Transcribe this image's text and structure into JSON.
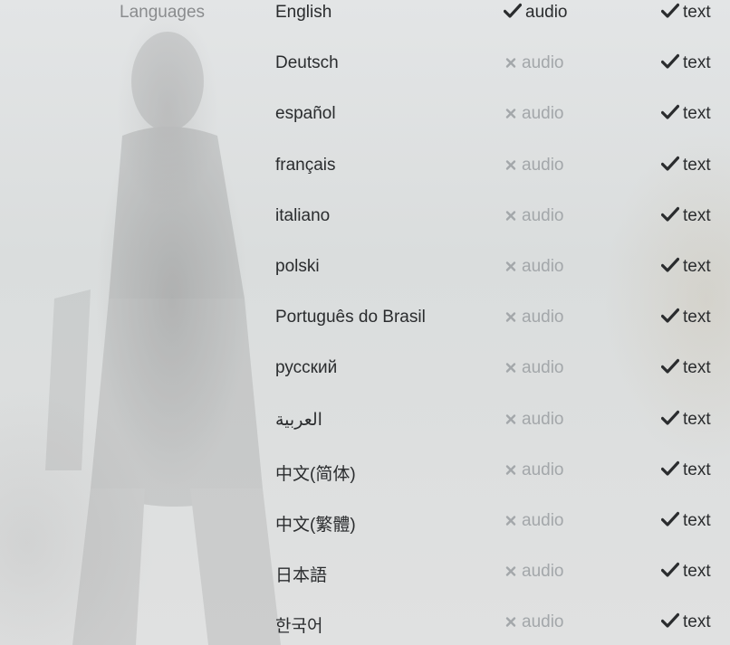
{
  "section_label": "Languages",
  "colors": {
    "supported": "#2a2c2e",
    "unsupported": "#a3a7aa"
  },
  "languages": [
    {
      "name": "English",
      "audio": {
        "supported": true,
        "label": "audio",
        "icon": "check-icon"
      },
      "text": {
        "supported": true,
        "label": "text",
        "icon": "check-icon"
      }
    },
    {
      "name": "Deutsch",
      "audio": {
        "supported": false,
        "label": "audio",
        "icon": "cross-icon"
      },
      "text": {
        "supported": true,
        "label": "text",
        "icon": "check-icon"
      }
    },
    {
      "name": "español",
      "audio": {
        "supported": false,
        "label": "audio",
        "icon": "cross-icon"
      },
      "text": {
        "supported": true,
        "label": "text",
        "icon": "check-icon"
      }
    },
    {
      "name": "français",
      "audio": {
        "supported": false,
        "label": "audio",
        "icon": "cross-icon"
      },
      "text": {
        "supported": true,
        "label": "text",
        "icon": "check-icon"
      }
    },
    {
      "name": "italiano",
      "audio": {
        "supported": false,
        "label": "audio",
        "icon": "cross-icon"
      },
      "text": {
        "supported": true,
        "label": "text",
        "icon": "check-icon"
      }
    },
    {
      "name": "polski",
      "audio": {
        "supported": false,
        "label": "audio",
        "icon": "cross-icon"
      },
      "text": {
        "supported": true,
        "label": "text",
        "icon": "check-icon"
      }
    },
    {
      "name": "Português do Brasil",
      "audio": {
        "supported": false,
        "label": "audio",
        "icon": "cross-icon"
      },
      "text": {
        "supported": true,
        "label": "text",
        "icon": "check-icon"
      }
    },
    {
      "name": "русский",
      "audio": {
        "supported": false,
        "label": "audio",
        "icon": "cross-icon"
      },
      "text": {
        "supported": true,
        "label": "text",
        "icon": "check-icon"
      }
    },
    {
      "name": "العربية",
      "audio": {
        "supported": false,
        "label": "audio",
        "icon": "cross-icon"
      },
      "text": {
        "supported": true,
        "label": "text",
        "icon": "check-icon"
      }
    },
    {
      "name": "中文(简体)",
      "audio": {
        "supported": false,
        "label": "audio",
        "icon": "cross-icon"
      },
      "text": {
        "supported": true,
        "label": "text",
        "icon": "check-icon"
      }
    },
    {
      "name": "中文(繁體)",
      "audio": {
        "supported": false,
        "label": "audio",
        "icon": "cross-icon"
      },
      "text": {
        "supported": true,
        "label": "text",
        "icon": "check-icon"
      }
    },
    {
      "name": "日本語",
      "audio": {
        "supported": false,
        "label": "audio",
        "icon": "cross-icon"
      },
      "text": {
        "supported": true,
        "label": "text",
        "icon": "check-icon"
      }
    },
    {
      "name": "한국어",
      "audio": {
        "supported": false,
        "label": "audio",
        "icon": "cross-icon"
      },
      "text": {
        "supported": true,
        "label": "text",
        "icon": "check-icon"
      }
    }
  ]
}
